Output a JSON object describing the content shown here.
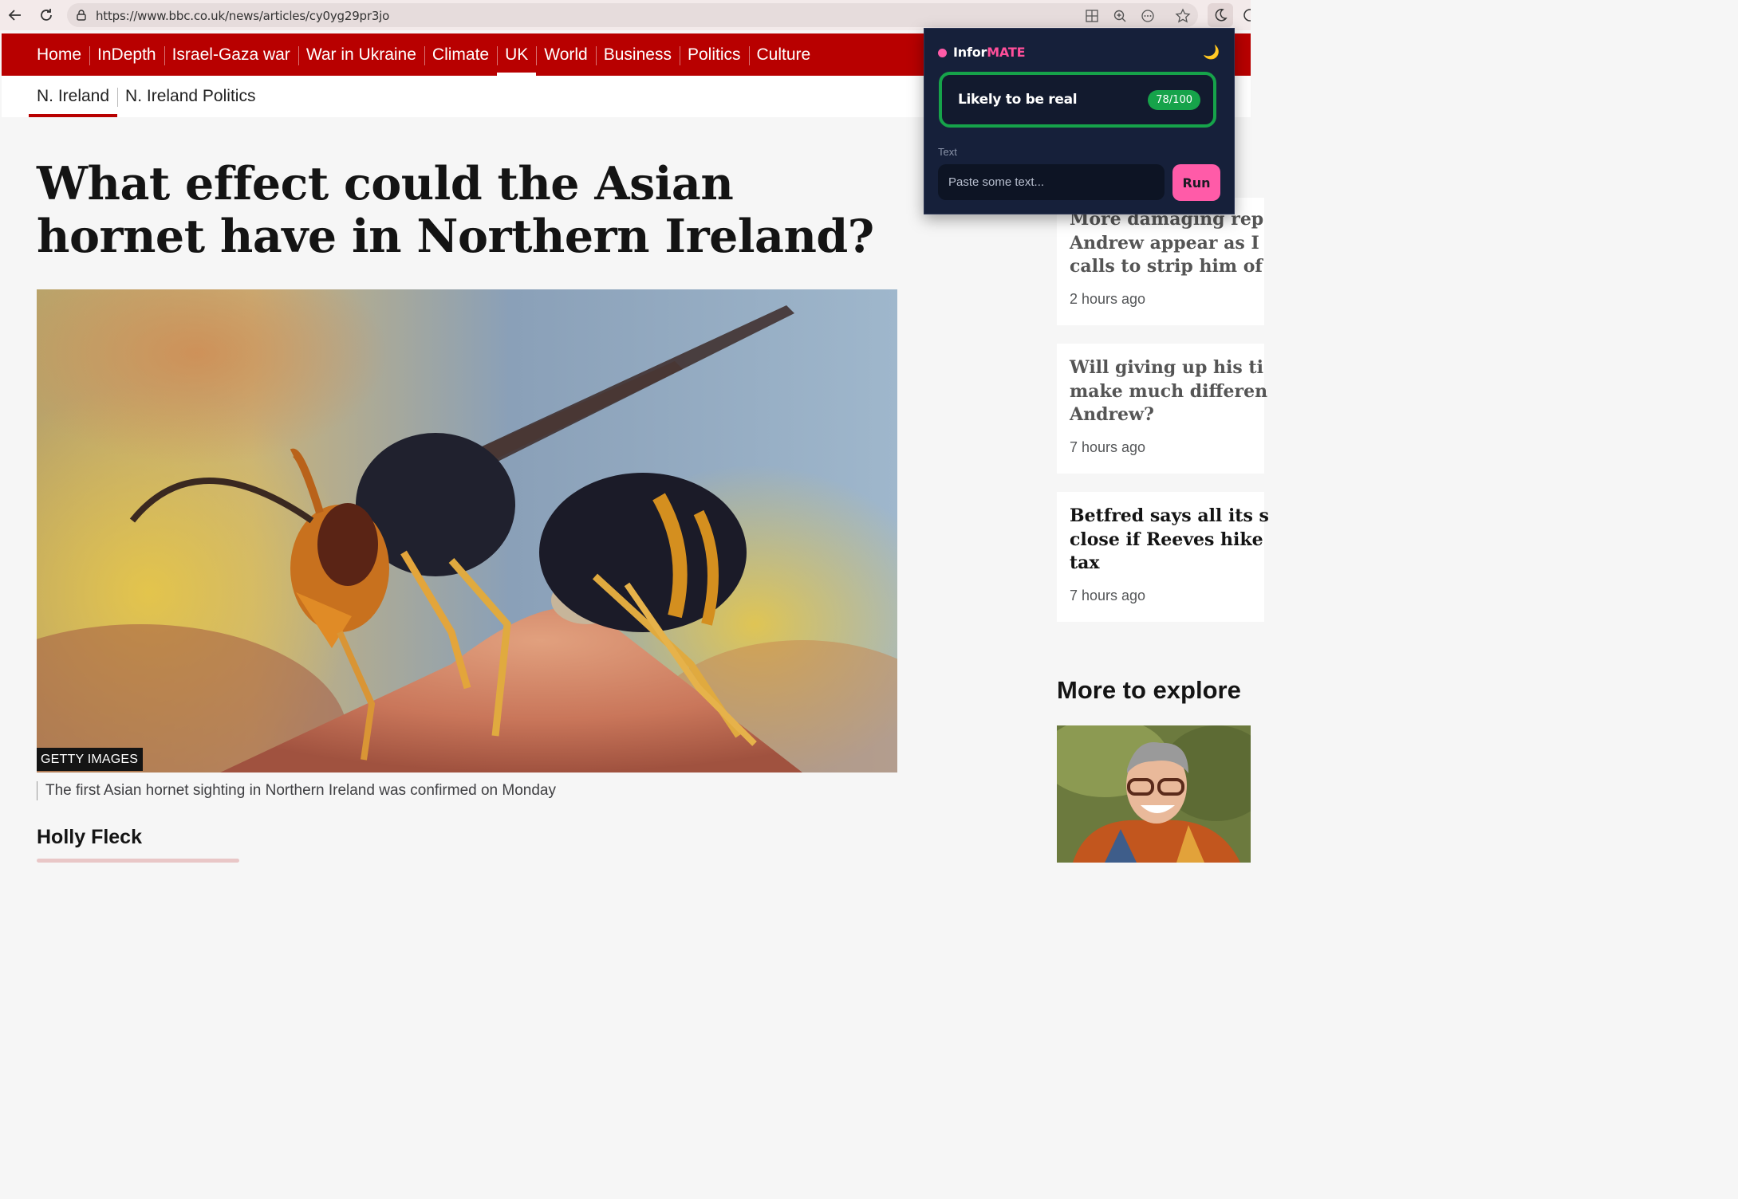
{
  "browser": {
    "url": "https://www.bbc.co.uk/news/articles/cy0yg29pr3jo",
    "icons": [
      "back-icon",
      "reload-icon",
      "site-info-icon",
      "apps-icon",
      "zoom-icon",
      "more-icon",
      "favorite-star-icon",
      "dark-mode-moon-icon"
    ]
  },
  "nav": {
    "items": [
      "Home",
      "InDepth",
      "Israel-Gaza war",
      "War in Ukraine",
      "Climate",
      "UK",
      "World",
      "Business",
      "Politics",
      "Culture"
    ],
    "active": "UK"
  },
  "subnav": {
    "items": [
      "N. Ireland",
      "N. Ireland Politics"
    ],
    "active": "N. Ireland"
  },
  "article": {
    "headline": "What effect could the Asian hornet have in Northern Ireland?",
    "image_credit": "GETTY IMAGES",
    "caption": "The first Asian hornet sighting in Northern Ireland was confirmed on Monday",
    "author": "Holly Fleck"
  },
  "sidebar": {
    "stories": [
      {
        "lines": [
          "More damaging rep",
          "Andrew appear as I",
          "calls to strip him of"
        ],
        "time": "2 hours ago"
      },
      {
        "lines": [
          "Will giving up his ti",
          "make much differen",
          "Andrew?"
        ],
        "time": "7 hours ago"
      },
      {
        "lines": [
          "Betfred says all its s",
          "close if Reeves hike",
          "tax"
        ],
        "time": "7 hours ago"
      }
    ],
    "more_to_explore": "More to explore"
  },
  "extension": {
    "brand_prefix": "Infor",
    "brand_accent": "MATE",
    "moon_icon": "🌙",
    "verdict": "Likely to be real",
    "score": "78/100",
    "field_label": "Text",
    "placeholder": "Paste some text...",
    "run_label": "Run",
    "colors": {
      "panel": "#16203a",
      "accent": "#ff5ba8",
      "verdict": "#16a34a"
    }
  },
  "colors": {
    "bbc_red": "#b80000",
    "page_bg": "#f6f6f6"
  }
}
